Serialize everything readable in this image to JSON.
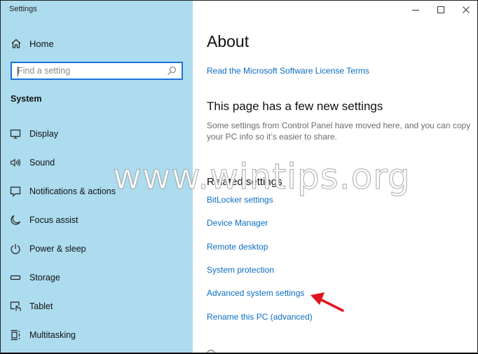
{
  "window": {
    "title": "Settings",
    "controls": {
      "minimize": "minimize-icon",
      "maximize": "maximize-icon",
      "close": "close-icon"
    }
  },
  "sidebar": {
    "home": {
      "label": "Home",
      "icon": "home-icon"
    },
    "search": {
      "placeholder": "Find a setting",
      "value": "",
      "icon": "search-icon"
    },
    "section_title": "System",
    "items": [
      {
        "label": "Display",
        "icon": "display-icon"
      },
      {
        "label": "Sound",
        "icon": "sound-icon"
      },
      {
        "label": "Notifications & actions",
        "icon": "notifications-icon"
      },
      {
        "label": "Focus assist",
        "icon": "focus-assist-icon"
      },
      {
        "label": "Power & sleep",
        "icon": "power-icon"
      },
      {
        "label": "Storage",
        "icon": "storage-icon"
      },
      {
        "label": "Tablet",
        "icon": "tablet-icon"
      },
      {
        "label": "Multitasking",
        "icon": "multitasking-icon"
      }
    ]
  },
  "main": {
    "title": "About",
    "license_link": "Read the Microsoft Software License Terms",
    "new_settings": {
      "heading": "This page has a few new settings",
      "description": "Some settings from Control Panel have moved here, and you can copy your PC info so it’s easier to share."
    },
    "related": {
      "heading": "Related settings",
      "links": [
        "BitLocker settings",
        "Device Manager",
        "Remote desktop",
        "System protection",
        "Advanced system settings",
        "Rename this PC (advanced)"
      ]
    }
  },
  "annotations": {
    "watermark": "www.wintips.org",
    "arrow_color": "#e0161e",
    "arrow_target": "Advanced system settings"
  },
  "colors": {
    "sidebar_bg": "#acdcee",
    "link": "#0b6ec2",
    "search_border": "#1a73d9"
  }
}
